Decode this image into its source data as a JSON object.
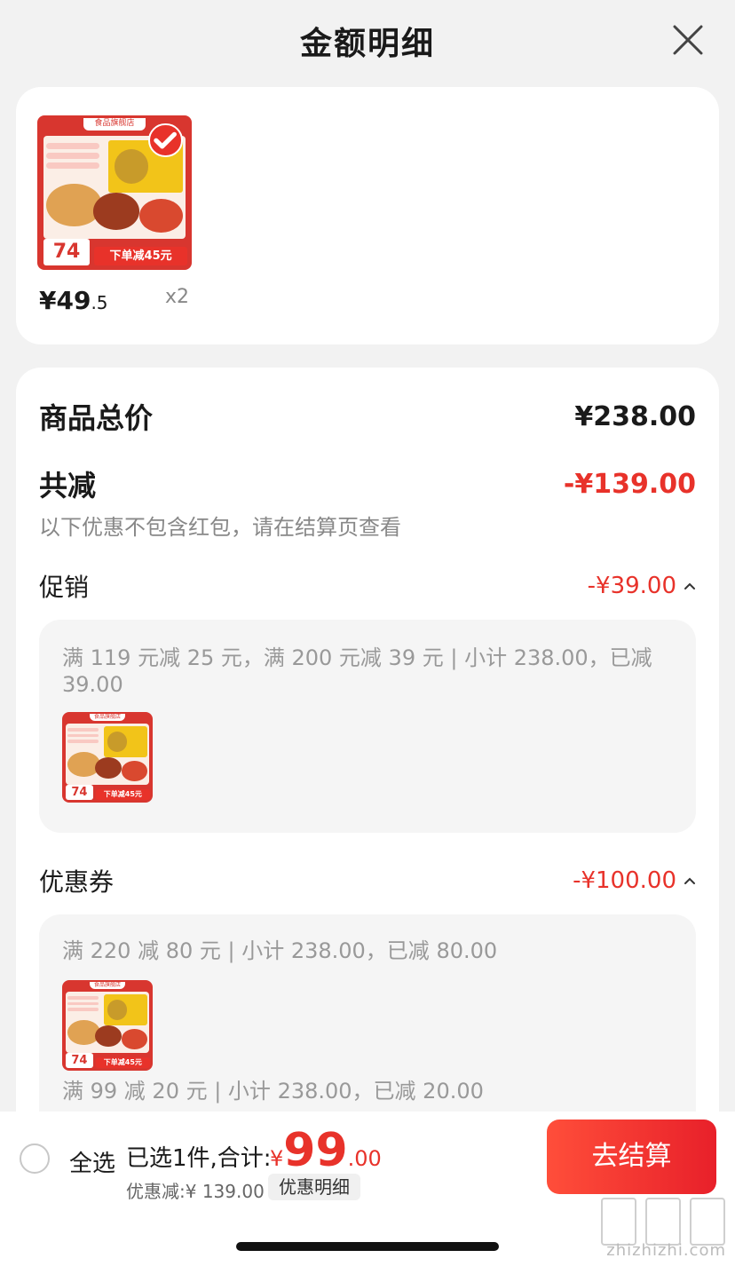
{
  "sheet": {
    "title": "金额明细"
  },
  "product": {
    "store_tag": "食品旗舰店",
    "thumb_price": "74",
    "thumb_promo": "下单减45元",
    "price_int": "¥49",
    "price_dec": ".5",
    "qty": "x2"
  },
  "detail": {
    "total_label": "商品总价",
    "total_value": "¥238.00",
    "discount_label": "共减",
    "discount_value": "-¥139.00",
    "note": "以下优惠不包含红包，请在结算页查看",
    "promo": {
      "label": "促销",
      "value": "-¥39.00",
      "text": "满 119 元减 25 元，满 200 元减 39 元 | 小计 238.00，已减 39.00"
    },
    "coupon": {
      "label": "优惠券",
      "value": "-¥100.00",
      "text1": "满 220 减 80 元 | 小计 238.00，已减 80.00",
      "text2": "满 99 减 20 元 | 小计 238.00，已减 20.00"
    }
  },
  "bottom": {
    "select_all": "全选",
    "selected": "已选1件,合计:",
    "currency": "¥",
    "total_int": "99",
    "total_dec": ".00",
    "discount": "优惠减:¥ 139.00",
    "detail_button": "优惠明细",
    "checkout": "去结算"
  },
  "watermark": "zhizhizhi.com",
  "colors": {
    "accent": "#e8322a",
    "background": "#f2f2f2"
  },
  "icons": {
    "close": "close-icon",
    "caret": "chevron-up-icon",
    "check": "check-icon"
  }
}
